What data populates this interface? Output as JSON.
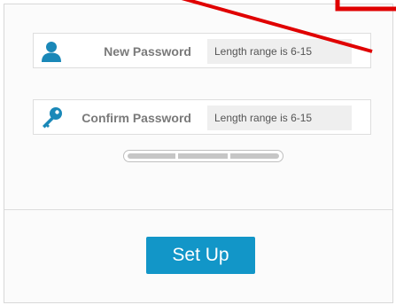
{
  "form": {
    "new_password": {
      "label": "New Password",
      "placeholder": "Length range is 6-15",
      "value": "",
      "icon": "user-icon"
    },
    "confirm_password": {
      "label": "Confirm Password",
      "placeholder": "Length range is 6-15",
      "value": "",
      "icon": "key-icon"
    },
    "strength_meter": {
      "segments": 3,
      "filled_segments": 0
    },
    "submit_label": "Set Up"
  },
  "colors": {
    "accent": "#1296c8",
    "icon": "#1a88b8",
    "annotation": "#e00000"
  }
}
